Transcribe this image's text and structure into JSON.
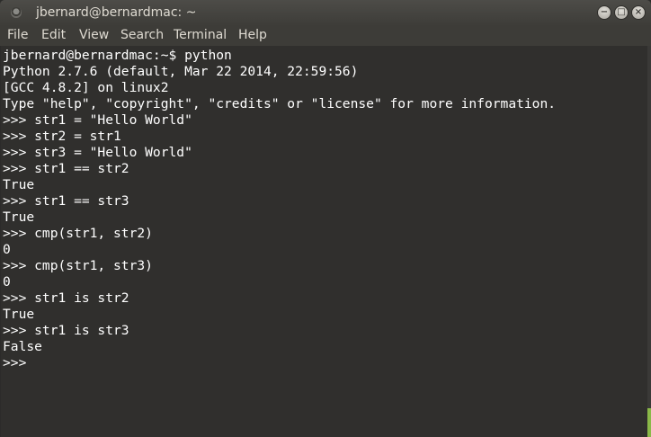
{
  "window": {
    "title": "jbernard@bernardmac: ~"
  },
  "controls": {
    "minimize": "−",
    "maximize": "□",
    "close": "×"
  },
  "menu": [
    "File",
    "Edit",
    "View",
    "Search",
    "Terminal",
    "Help"
  ],
  "terminal": {
    "lines": [
      "jbernard@bernardmac:~$ python",
      "Python 2.7.6 (default, Mar 22 2014, 22:59:56)",
      "[GCC 4.8.2] on linux2",
      "Type \"help\", \"copyright\", \"credits\" or \"license\" for more information.",
      ">>> str1 = \"Hello World\"",
      ">>> str2 = str1",
      ">>> str3 = \"Hello World\"",
      ">>> str1 == str2",
      "True",
      ">>> str1 == str3",
      "True",
      ">>> cmp(str1, str2)",
      "0",
      ">>> cmp(str1, str3)",
      "0",
      ">>> str1 is str2",
      "True",
      ">>> str1 is str3",
      "False",
      ">>> "
    ]
  },
  "colors": {
    "titlebar": "#3d3c38",
    "terminal_bg": "#302f2d",
    "text": "#ffffff",
    "scroll_thumb": "#8ab848"
  }
}
